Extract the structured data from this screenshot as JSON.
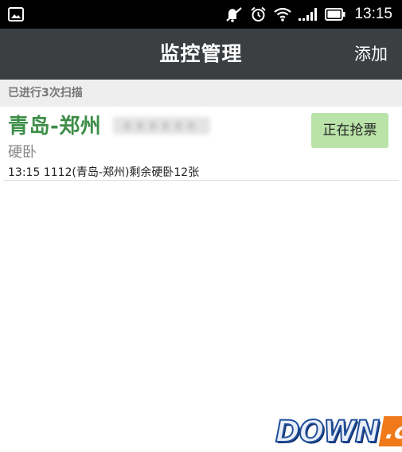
{
  "status_bar": {
    "time": "13:15",
    "icons": [
      "gallery-icon",
      "mute-icon",
      "alarm-icon",
      "wifi-icon",
      "signal-icon",
      "battery-icon"
    ]
  },
  "header": {
    "title": "监控管理",
    "add_label": "添加"
  },
  "scan_info": {
    "text": "已进行3次扫描"
  },
  "tasks": [
    {
      "route": "青岛-郑州",
      "seat_type": "硬卧",
      "detail": "13:15 1112(青岛-郑州)剩余硬卧12张",
      "status_button": "正在抢票"
    }
  ],
  "watermark": {
    "brand": "DOWN",
    "suffix": ".cc"
  },
  "colors": {
    "title_bar": "#3b3f42",
    "route_green": "#3e8e48",
    "button_green": "#b9e3a8",
    "scan_header_bg": "#eeeeee",
    "watermark_blue": "#1f4e9c",
    "watermark_orange": "#f0791a"
  }
}
